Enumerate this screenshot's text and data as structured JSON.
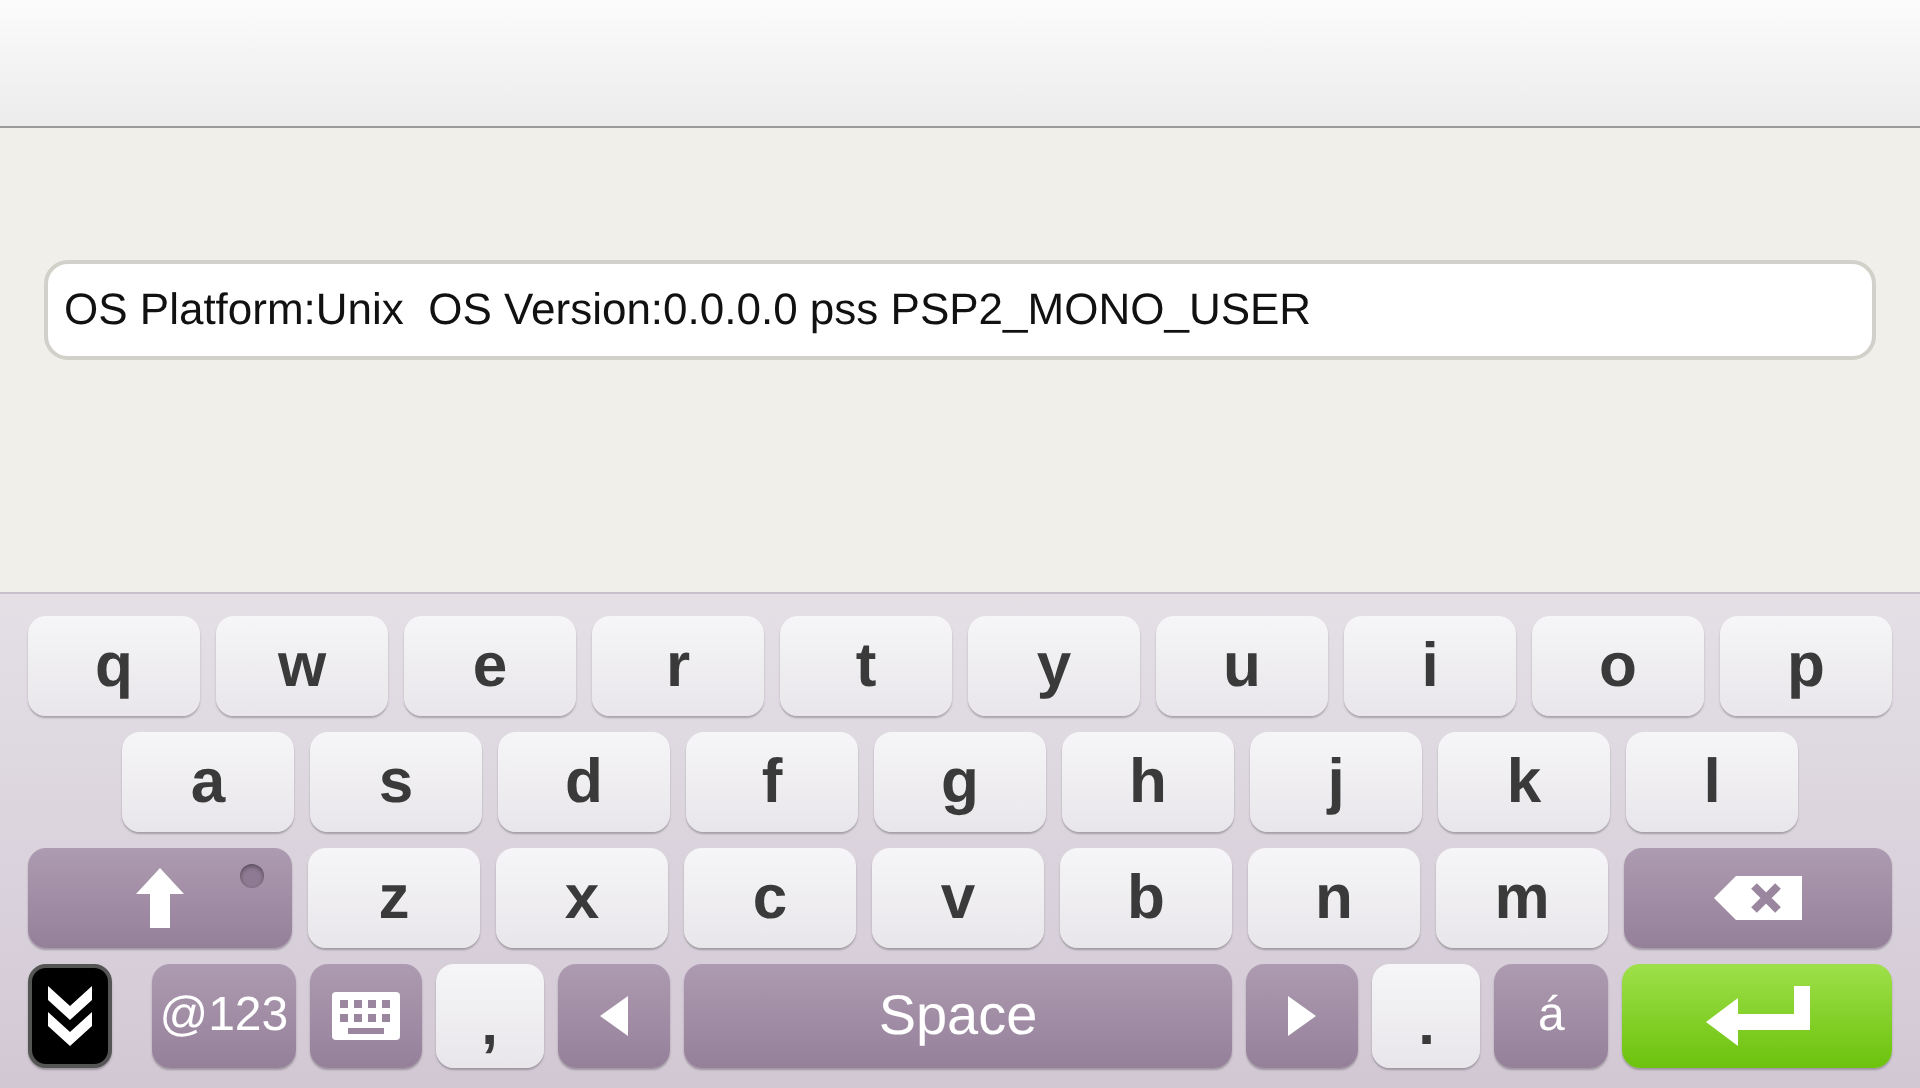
{
  "text_field": {
    "value": "OS Platform:Unix  OS Version:0.0.0.0 pss PSP2_MONO_USER"
  },
  "keyboard": {
    "rows": [
      {
        "keys": [
          {
            "kind": "letter",
            "label": "q"
          },
          {
            "kind": "letter",
            "label": "w"
          },
          {
            "kind": "letter",
            "label": "e"
          },
          {
            "kind": "letter",
            "label": "r"
          },
          {
            "kind": "letter",
            "label": "t"
          },
          {
            "kind": "letter",
            "label": "y"
          },
          {
            "kind": "letter",
            "label": "u"
          },
          {
            "kind": "letter",
            "label": "i"
          },
          {
            "kind": "letter",
            "label": "o"
          },
          {
            "kind": "letter",
            "label": "p"
          }
        ]
      },
      {
        "keys": [
          {
            "kind": "letter",
            "label": "a"
          },
          {
            "kind": "letter",
            "label": "s"
          },
          {
            "kind": "letter",
            "label": "d"
          },
          {
            "kind": "letter",
            "label": "f"
          },
          {
            "kind": "letter",
            "label": "g"
          },
          {
            "kind": "letter",
            "label": "h"
          },
          {
            "kind": "letter",
            "label": "j"
          },
          {
            "kind": "letter",
            "label": "k"
          },
          {
            "kind": "letter",
            "label": "l"
          }
        ]
      },
      {
        "keys": [
          {
            "kind": "shift",
            "on": false
          },
          {
            "kind": "letter",
            "label": "z"
          },
          {
            "kind": "letter",
            "label": "x"
          },
          {
            "kind": "letter",
            "label": "c"
          },
          {
            "kind": "letter",
            "label": "v"
          },
          {
            "kind": "letter",
            "label": "b"
          },
          {
            "kind": "letter",
            "label": "n"
          },
          {
            "kind": "letter",
            "label": "m"
          },
          {
            "kind": "backspace"
          }
        ]
      },
      {
        "keys": [
          {
            "kind": "hide"
          },
          {
            "kind": "symbols",
            "label": "@123"
          },
          {
            "kind": "layout"
          },
          {
            "kind": "punct",
            "label": ","
          },
          {
            "kind": "left"
          },
          {
            "kind": "space",
            "label": "Space"
          },
          {
            "kind": "right"
          },
          {
            "kind": "punct",
            "label": "."
          },
          {
            "kind": "accent",
            "label": "á"
          },
          {
            "kind": "enter"
          }
        ]
      }
    ]
  }
}
